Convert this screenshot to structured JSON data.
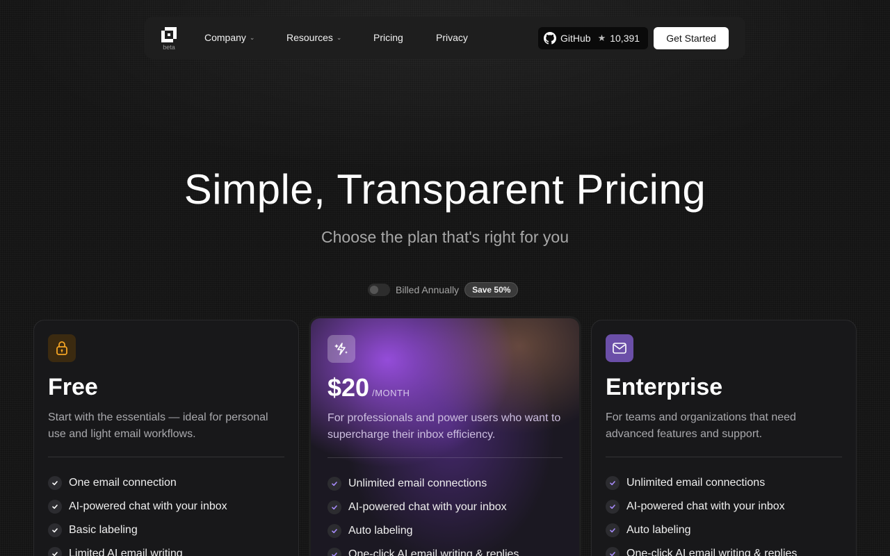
{
  "nav": {
    "logo_sub": "beta",
    "links": [
      {
        "label": "Company",
        "dropdown": true
      },
      {
        "label": "Resources",
        "dropdown": true
      },
      {
        "label": "Pricing",
        "dropdown": false
      },
      {
        "label": "Privacy",
        "dropdown": false
      }
    ],
    "github": {
      "label": "GitHub",
      "stars": "10,391",
      "icon": "github-icon",
      "star_icon": "star-icon"
    },
    "cta": "Get Started"
  },
  "hero": {
    "title": "Simple, Transparent Pricing",
    "subtitle": "Choose the plan that's right for you"
  },
  "billing": {
    "label": "Billed Annually",
    "annual_enabled": false,
    "badge": "Save 50%"
  },
  "plans": [
    {
      "id": "free",
      "icon": "lock-icon",
      "icon_bg": "#3b2a10",
      "icon_color": "#f5a524",
      "title": "Free",
      "description": "Start with the essentials — ideal for personal use and light email workflows.",
      "features": [
        "One email connection",
        "AI-powered chat with your inbox",
        "Basic labeling",
        "Limited AI email writing"
      ]
    },
    {
      "id": "pro",
      "icon": "sparkle-bolt-icon",
      "icon_bg": "rgba(255,255,255,0.25)",
      "icon_color": "#ffffff",
      "price": "$20",
      "period": "/MONTH",
      "description": "For professionals and power users who want to supercharge their inbox efficiency.",
      "features": [
        "Unlimited email connections",
        "AI-powered chat with your inbox",
        "Auto labeling",
        "One-click AI email writing & replies"
      ]
    },
    {
      "id": "enterprise",
      "icon": "mail-icon",
      "icon_bg": "#6b4fa8",
      "icon_color": "#ffffff",
      "title": "Enterprise",
      "description": "For teams and organizations that need advanced features and support.",
      "features": [
        "Unlimited email connections",
        "AI-powered chat with your inbox",
        "Auto labeling",
        "One-click AI email writing & replies"
      ]
    }
  ],
  "colors": {
    "background": "#121212",
    "check_color": "#a78bfa",
    "free_check_color": "#ffffff"
  }
}
